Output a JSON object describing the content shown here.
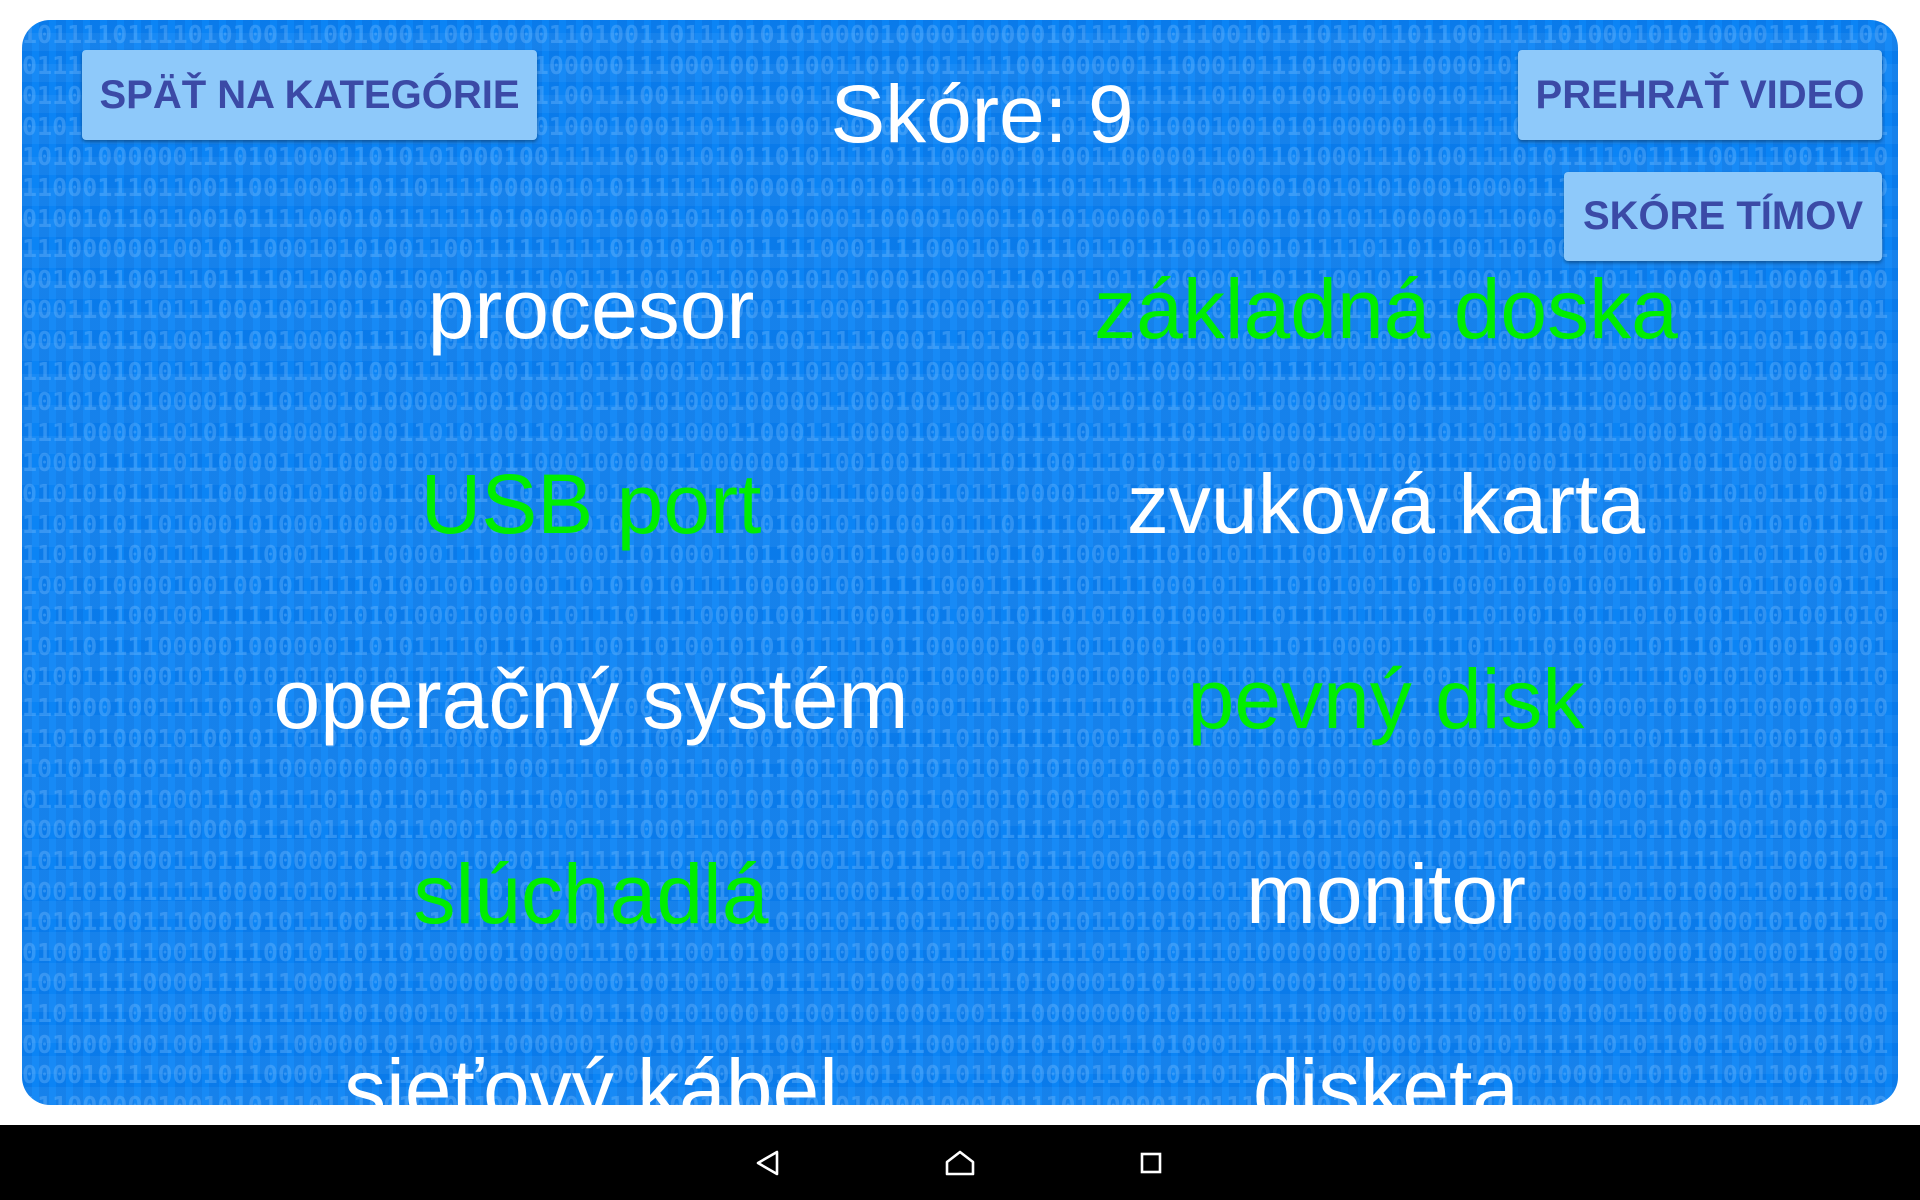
{
  "header": {
    "back_button_label": "SPÄŤ NA KATEGÓRIE",
    "score_label": "Skóre:",
    "score_value": "9",
    "play_video_label": "PREHRAŤ VIDEO",
    "team_scores_label": "SKÓRE TÍMOV"
  },
  "words": {
    "left": [
      {
        "text": "procesor",
        "color": "#ffffff"
      },
      {
        "text": "USB port",
        "color": "#00ee00"
      },
      {
        "text": "operačný systém",
        "color": "#ffffff"
      },
      {
        "text": "slúchadlá",
        "color": "#00ee00"
      },
      {
        "text": "sieťový kábel",
        "color": "#ffffff"
      }
    ],
    "right": [
      {
        "text": "základná doska",
        "color": "#00ee00"
      },
      {
        "text": "zvuková karta",
        "color": "#ffffff"
      },
      {
        "text": "pevný disk",
        "color": "#00ee00"
      },
      {
        "text": "monitor",
        "color": "#ffffff"
      },
      {
        "text": "disketa",
        "color": "#ffffff"
      }
    ]
  },
  "theme": {
    "background": "#0b84f5",
    "button_fill": "#8ec9fa",
    "button_text": "#3b4aa6",
    "correct_word_color": "#00ee00",
    "default_word_color": "#ffffff"
  },
  "background_pattern": "binary-digits",
  "nav_bar": {
    "back_icon": "triangle-back-icon",
    "home_icon": "home-outline-icon",
    "recents_icon": "square-recents-icon"
  }
}
